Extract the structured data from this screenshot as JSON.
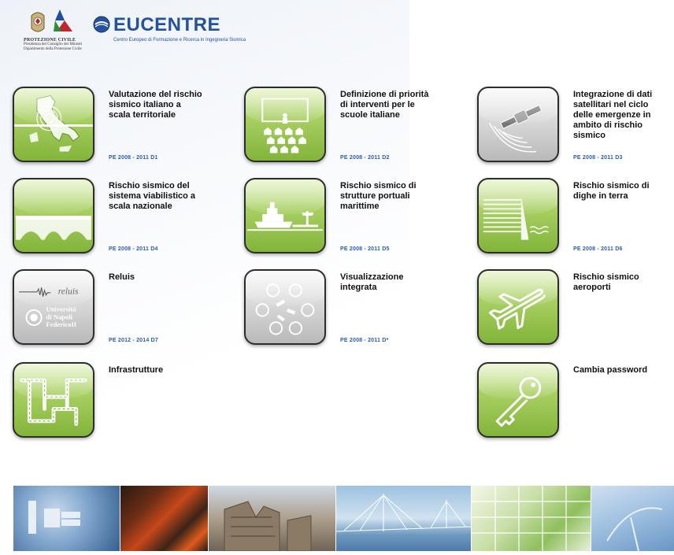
{
  "header": {
    "protezione_civile": {
      "name": "PROTEZIONE CIVILE",
      "line1": "Presidenza del Consiglio dei Ministri",
      "line2": "Dipartimento della Protezione Civile"
    },
    "eucentre": {
      "name": "EUCENTRE",
      "subtitle": "Centro Europeo di Formazione e Ricerca in Ingegneria Sismica"
    }
  },
  "tiles": [
    {
      "title": "Valutazione del rischio sismico italiano a scala territoriale",
      "code": "PE 2008 - 2011 D1",
      "icon": "italy-map-icon"
    },
    {
      "title": "Definizione di priorità di interventi per le scuole italiane",
      "code": "PE 2008 - 2011 D2",
      "icon": "classroom-icon"
    },
    {
      "title": "Integrazione di dati satellitari nel ciclo delle emergenze in ambito di rischio sismico",
      "code": "PE 2008 - 2011 D3",
      "icon": "satellite-icon"
    },
    {
      "title": "Rischio sismico del sistema viabilistico a scala nazionale",
      "code": "PE 2008 - 2011 D4",
      "icon": "bridge-icon"
    },
    {
      "title": "Rischio sismico di strutture portuali marittime",
      "code": "PE 2008 - 2011 D5",
      "icon": "ship-port-icon"
    },
    {
      "title": "Rischio sismico di dighe in terra",
      "code": "PE 2008 - 2011 D6",
      "icon": "dam-icon"
    },
    {
      "title": "Reluis",
      "code": "PE 2012 - 2014 D7",
      "icon": "reluis-logo-icon",
      "logo_text": {
        "reluis": "reluis",
        "univ1": "Università",
        "univ2": "di Napoli",
        "univ3": "FedericoII"
      }
    },
    {
      "title": "Visualizzazione integrata",
      "code": "PE 2008 - 2011 D*",
      "icon": "network-circles-icon"
    },
    {
      "title": "Rischio sismico aeroporti",
      "code": "",
      "icon": "airplane-icon"
    },
    {
      "title": "Infrastrutture",
      "code": "",
      "icon": "road-network-icon"
    },
    {
      "title": "Cambia password",
      "code": "",
      "icon": "key-icon"
    }
  ],
  "footer": {
    "photos": [
      "space-station",
      "lava",
      "collapsed-building",
      "cable-bridge",
      "world-map-grid",
      "antenna-sky"
    ]
  },
  "colors": {
    "accent_green": "#8cbf3f",
    "code_blue": "#2b5da8",
    "eucentre_blue": "#24529e"
  }
}
